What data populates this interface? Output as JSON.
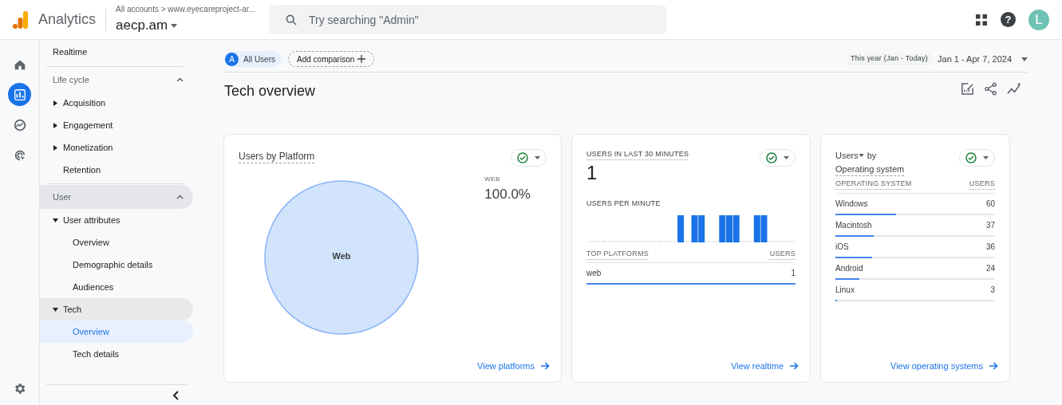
{
  "header": {
    "product": "Analytics",
    "help_glyph": "?",
    "breadcrumb": "All accounts > www.eyecareproject-ar...",
    "property": "aecp.am",
    "search_placeholder": "Try searching \"Admin\"",
    "avatar_letter": "L"
  },
  "rail": [
    {
      "kind": "home",
      "selected": false
    },
    {
      "kind": "reports",
      "selected": true
    },
    {
      "kind": "explore",
      "selected": false
    },
    {
      "kind": "advertising",
      "selected": false
    }
  ],
  "nav": [
    {
      "kind": "link",
      "label": "Realtime"
    },
    {
      "kind": "section",
      "label": "Life cycle",
      "expanded": true,
      "highlighted": false,
      "children": [
        {
          "label": "Acquisition",
          "expanded": false,
          "selected": false
        },
        {
          "label": "Engagement",
          "expanded": false,
          "selected": false
        },
        {
          "label": "Monetization",
          "expanded": false,
          "selected": false
        },
        {
          "label": "Retention",
          "selected": false
        }
      ]
    },
    {
      "kind": "section",
      "label": "User",
      "expanded": true,
      "highlighted": true,
      "children": [
        {
          "label": "User attributes",
          "expanded": true,
          "selected": false,
          "children": [
            {
              "label": "Overview",
              "selected": false
            },
            {
              "label": "Demographic details",
              "selected": false
            },
            {
              "label": "Audiences",
              "selected": false
            }
          ]
        },
        {
          "label": "Tech",
          "expanded": true,
          "selected": true,
          "children": [
            {
              "label": "Overview",
              "selected": true
            },
            {
              "label": "Tech details",
              "selected": false
            }
          ]
        }
      ]
    }
  ],
  "toolbar": {
    "segment_letter": "A",
    "segment": "All Users",
    "add_comparison": "Add comparison",
    "date_preset": "This year (Jan - Today)",
    "date_range": "Jan 1 - Apr 7, 2024"
  },
  "page_title": "Tech overview",
  "platform_card": {
    "title": "Users by Platform",
    "legend_label": "WEB",
    "legend_value": "100.0%",
    "link": "View platforms",
    "chart_data": {
      "type": "pie",
      "categories": [
        "Web"
      ],
      "values": [
        100.0
      ]
    }
  },
  "realtime_card": {
    "title": "USERS IN LAST 30 MINUTES",
    "value": "1",
    "subtitle": "USERS PER MINUTE",
    "table_columns": [
      "TOP PLATFORMS",
      "USERS"
    ],
    "rows": [
      {
        "name": "web",
        "value": "1",
        "level": 1.0
      }
    ],
    "link": "View realtime"
  },
  "os_card": {
    "title_metric": "Users",
    "title_by": "by",
    "title_dimension": "Operating system",
    "table_columns": [
      "OPERATING SYSTEM",
      "USERS"
    ],
    "rows": [
      {
        "name": "Windows",
        "value": "60",
        "level": 0.38
      },
      {
        "name": "Macintosh",
        "value": "37",
        "level": 0.24
      },
      {
        "name": "iOS",
        "value": "36",
        "level": 0.23
      },
      {
        "name": "Android",
        "value": "24",
        "level": 0.15
      },
      {
        "name": "Linux",
        "value": "3",
        "level": 0.01
      }
    ],
    "link": "View operating systems"
  }
}
